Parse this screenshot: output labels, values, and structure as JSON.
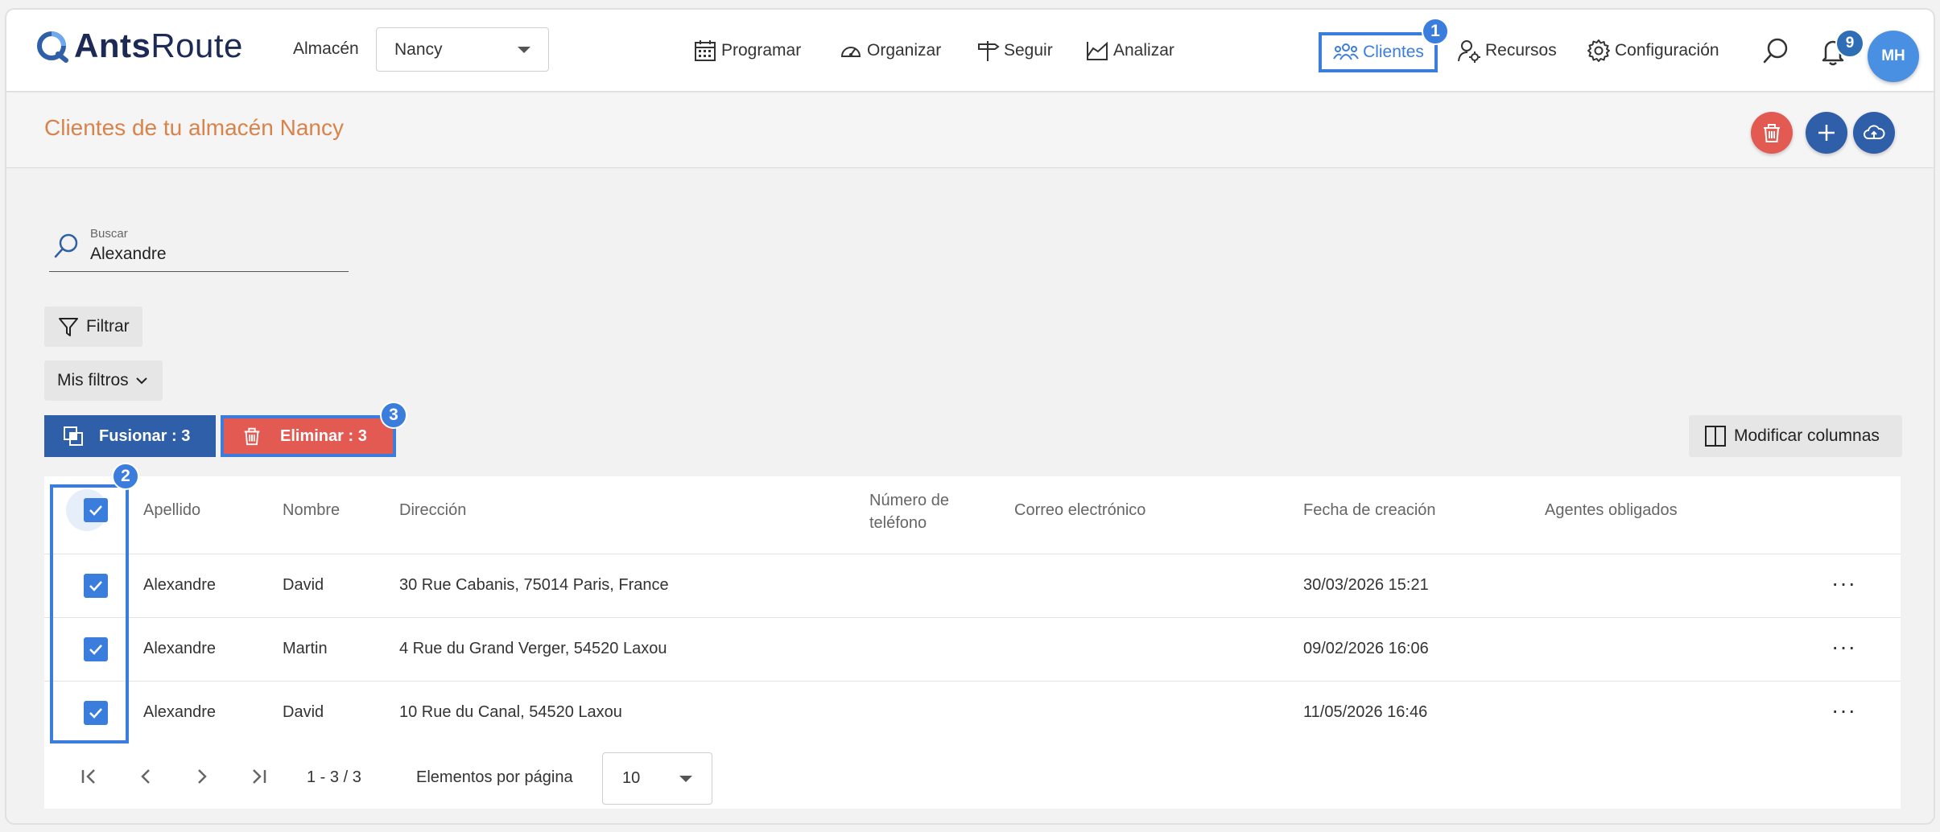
{
  "header": {
    "logo_bold": "Ants",
    "logo_light": "Route",
    "warehouse_label": "Almacén",
    "warehouse_value": "Nancy",
    "nav": {
      "programar": "Programar",
      "organizar": "Organizar",
      "seguir": "Seguir",
      "analizar": "Analizar",
      "clientes": "Clientes",
      "recursos": "Recursos",
      "configuracion": "Configuración"
    },
    "notifications_count": "9",
    "avatar_initials": "MH"
  },
  "annotations": {
    "one": "1",
    "two": "2",
    "three": "3"
  },
  "page": {
    "title": "Clientes de tu almacén Nancy"
  },
  "search": {
    "label": "Buscar",
    "value": "Alexandre"
  },
  "filters": {
    "filter_label": "Filtrar",
    "my_filters_label": "Mis filtros"
  },
  "actions": {
    "merge_label": "Fusionar : 3",
    "delete_label": "Eliminar : 3",
    "modify_columns_label": "Modificar columnas"
  },
  "table": {
    "columns": {
      "apellido": "Apellido",
      "nombre": "Nombre",
      "direccion": "Dirección",
      "telefono_1": "Número de",
      "telefono_2": "teléfono",
      "correo": "Correo electrónico",
      "fecha": "Fecha de creación",
      "agentes": "Agentes obligados"
    },
    "rows": [
      {
        "apellido": "Alexandre",
        "nombre": "David",
        "direccion": "30 Rue Cabanis, 75014 Paris, France",
        "fecha": "30/03/2026 15:21",
        "more": "···"
      },
      {
        "apellido": "Alexandre",
        "nombre": "Martin",
        "direccion": "4 Rue du Grand Verger, 54520 Laxou",
        "fecha": "09/02/2026 16:06",
        "more": "···"
      },
      {
        "apellido": "Alexandre",
        "nombre": "David",
        "direccion": "10 Rue du Canal, 54520 Laxou",
        "fecha": "11/05/2026 16:46",
        "more": "···"
      }
    ]
  },
  "pager": {
    "range": "1 - 3 / 3",
    "per_page_label": "Elementos por página",
    "per_page_value": "10"
  },
  "colors": {
    "accent": "#3b7ddd",
    "danger": "#e25a52",
    "primary_dark": "#2f5fa8",
    "title": "#d9834a"
  }
}
